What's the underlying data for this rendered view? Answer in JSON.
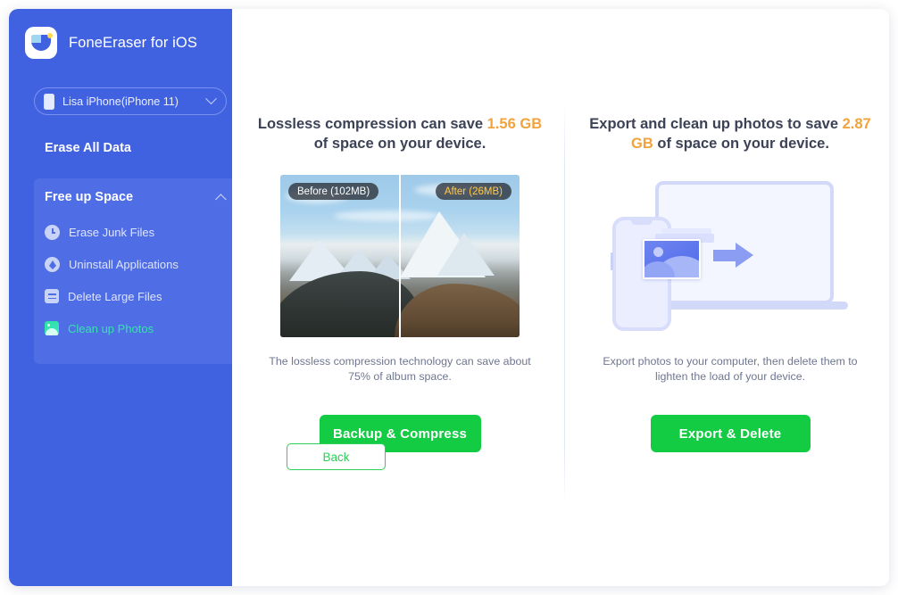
{
  "app": {
    "brand_title": "FoneEraser for iOS",
    "logo_icon": "foneeraser-logo-icon"
  },
  "titlebar": {
    "buttons": [
      {
        "name": "diamond-icon",
        "label": ""
      },
      {
        "name": "menu-icon",
        "label": ""
      },
      {
        "name": "feedback-icon",
        "label": ""
      },
      {
        "name": "minimize-icon",
        "label": ""
      },
      {
        "name": "close-icon",
        "label": ""
      }
    ]
  },
  "sidebar": {
    "device_selector": {
      "value": "Lisa iPhone(iPhone 11)",
      "icon": "phone-icon",
      "caret": "chevron-down-icon"
    },
    "erase_all_data_label": "Erase All Data",
    "section": {
      "title": "Free up Space",
      "caret": "chevron-up-icon",
      "expanded": true
    },
    "items": [
      {
        "label": "Erase Junk Files",
        "icon": "clock-icon",
        "active": false
      },
      {
        "label": "Uninstall Applications",
        "icon": "apps-icon",
        "active": false
      },
      {
        "label": "Delete Large Files",
        "icon": "document-icon",
        "active": false
      },
      {
        "label": "Clean up Photos",
        "icon": "photo-icon",
        "active": true
      }
    ]
  },
  "main": {
    "left_panel": {
      "headline_prefix": "Lossless compression can save ",
      "headline_amount": "1.56 GB",
      "headline_suffix": " of space on your device.",
      "media": {
        "kind": "before-after-photo",
        "before_chip": "Before (102MB)",
        "after_chip": "After (26MB)"
      },
      "caption": "The lossless compression technology can save about 75% of album space.",
      "cta_label": "Backup & Compress"
    },
    "right_panel": {
      "headline_prefix": "Export and clean up photos to save ",
      "headline_amount": "2.87 GB",
      "headline_suffix": " of space on your device.",
      "media": {
        "kind": "export-illustration"
      },
      "caption": "Export photos to your computer, then delete them to lighten the load of your device.",
      "cta_label": "Export & Delete"
    },
    "back_label": "Back"
  },
  "colors": {
    "sidebar_bg": "#4162e0",
    "sidebar_panel_bg": "#4f6de4",
    "accent_green": "#13cc44",
    "accent_teal": "#38e1b0",
    "amount_orange": "#f2a33c",
    "diamond_orange": "#e8a33a",
    "text_dark": "#3c4256",
    "text_muted": "#6f7690"
  }
}
